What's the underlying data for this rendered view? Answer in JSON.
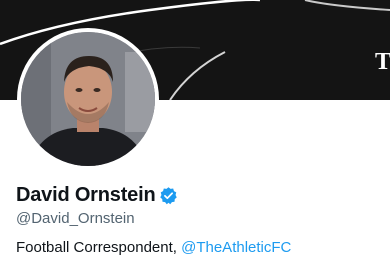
{
  "profile": {
    "display_name": "David Ornstein",
    "handle": "@David_Ornstein",
    "verified": true,
    "bio": {
      "text": "Football Correspondent, ",
      "mention": "@TheAthleticFC"
    }
  },
  "banner": {
    "visible_text": "T"
  },
  "icons": {
    "verified": "verified-badge-icon",
    "avatar": "profile-photo"
  },
  "colors": {
    "banner_background": "#141414",
    "link": "#1d9bf0",
    "verified_badge": "#1d9bf0",
    "name_text": "#0f1419",
    "secondary_text": "#536471"
  }
}
